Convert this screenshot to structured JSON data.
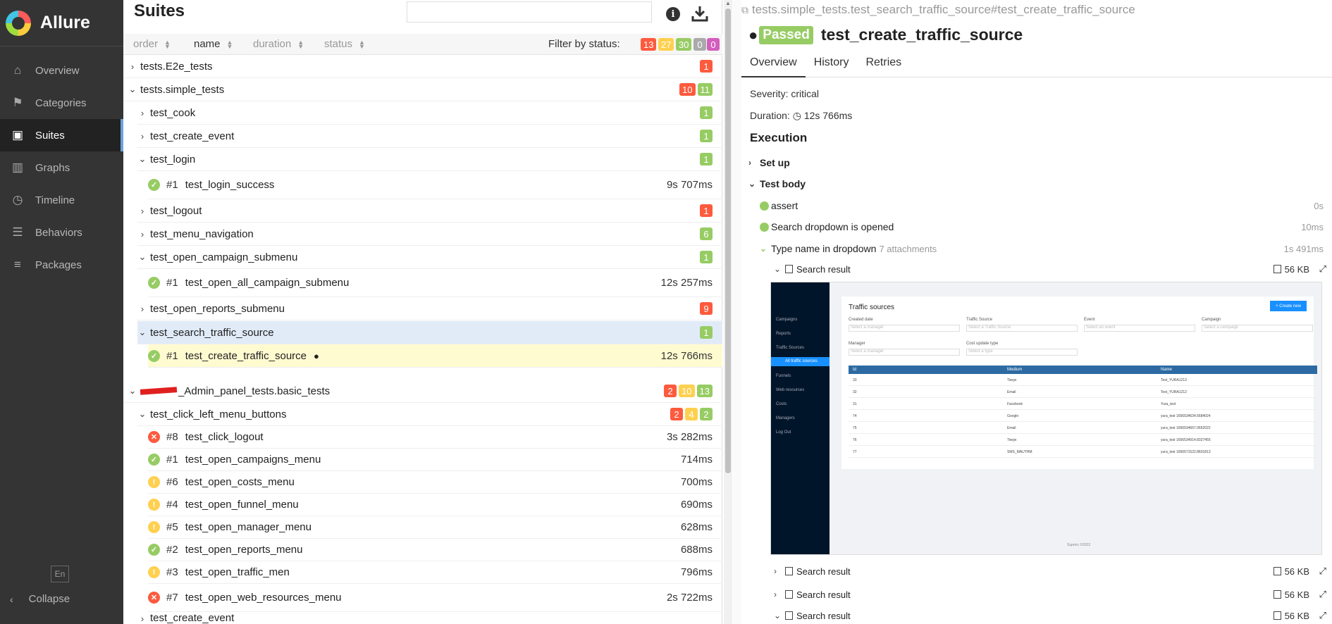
{
  "app": {
    "brand": "Allure",
    "language": "En",
    "collapse_label": "Collapse"
  },
  "nav": [
    {
      "label": "Overview",
      "icon": "home-icon"
    },
    {
      "label": "Categories",
      "icon": "flag-icon"
    },
    {
      "label": "Suites",
      "icon": "briefcase-icon",
      "active": true
    },
    {
      "label": "Graphs",
      "icon": "bar-chart-icon"
    },
    {
      "label": "Timeline",
      "icon": "clock-icon"
    },
    {
      "label": "Behaviors",
      "icon": "list-icon"
    },
    {
      "label": "Packages",
      "icon": "align-left-icon"
    }
  ],
  "suites": {
    "title": "Suites",
    "sort": {
      "order": "order",
      "name": "name",
      "duration": "duration",
      "status": "status"
    },
    "filter_label": "Filter by status:",
    "filter_counts": {
      "failed": "13",
      "broken": "27",
      "passed": "30",
      "skipped": "0",
      "unknown": "0"
    },
    "rows": [
      {
        "text": "tests.E2e_tests",
        "caret": "›",
        "badges": [
          "1"
        ]
      },
      {
        "text": "tests.simple_tests",
        "caret": "⌄",
        "badges": [
          "10",
          "11"
        ]
      },
      {
        "text": "test_cook",
        "badges": [
          "1"
        ]
      },
      {
        "text": "test_create_event",
        "badges": [
          "1"
        ]
      },
      {
        "text": "test_login",
        "badges": [
          "1"
        ]
      },
      {
        "num": "#1",
        "text": "test_login_success",
        "dur": "9s 707ms"
      },
      {
        "text": "test_logout",
        "badges": [
          "1"
        ]
      },
      {
        "text": "test_menu_navigation",
        "badges": [
          "6"
        ]
      },
      {
        "text": "test_open_campaign_submenu",
        "badges": [
          "1"
        ]
      },
      {
        "num": "#1",
        "text": "test_open_all_campaign_submenu",
        "dur": "12s 257ms"
      },
      {
        "text": "test_open_reports_submenu",
        "badges": [
          "9"
        ]
      },
      {
        "text": "test_search_traffic_source",
        "badges": [
          "1"
        ]
      },
      {
        "num": "#1",
        "text": "test_create_traffic_source",
        "dur": "12s 766ms"
      },
      {
        "text": "_Admin_panel_tests.basic_tests",
        "badges": [
          "2",
          "10",
          "13"
        ]
      },
      {
        "text": "test_click_left_menu_buttons",
        "badges": [
          "2",
          "4",
          "2"
        ]
      },
      {
        "num": "#8",
        "text": "test_click_logout",
        "dur": "3s 282ms"
      },
      {
        "num": "#1",
        "text": "test_open_campaigns_menu",
        "dur": "714ms"
      },
      {
        "num": "#6",
        "text": "test_open_costs_menu",
        "dur": "700ms"
      },
      {
        "num": "#4",
        "text": "test_open_funnel_menu",
        "dur": "690ms"
      },
      {
        "num": "#5",
        "text": "test_open_manager_menu",
        "dur": "628ms"
      },
      {
        "num": "#2",
        "text": "test_open_reports_menu",
        "dur": "688ms"
      },
      {
        "num": "#3",
        "text": "test_open_traffic_men",
        "dur": "796ms"
      },
      {
        "num": "#7",
        "text": "test_open_web_resources_menu",
        "dur": "2s 722ms"
      },
      {
        "text": "test_create_event"
      }
    ]
  },
  "detail": {
    "path": "tests.simple_tests.test_search_traffic_source#test_create_traffic_source",
    "status": "Passed",
    "name": "test_create_traffic_source",
    "tabs": [
      "Overview",
      "History",
      "Retries"
    ],
    "severity": "Severity: critical",
    "duration_label": "Duration:",
    "duration": "12s 766ms",
    "execution": "Execution",
    "set_up": "Set up",
    "test_body": "Test body",
    "steps": [
      {
        "label": "assert",
        "time": "0s"
      },
      {
        "label": "Search dropdown is opened",
        "time": "10ms"
      },
      {
        "label": "Type name in dropdown",
        "attachments": "7 attachments",
        "time": "1s 491ms"
      }
    ],
    "attachments": [
      {
        "label": "Search result",
        "size": "56 KB"
      },
      {
        "label": "Search result",
        "size": "56 KB"
      },
      {
        "label": "Search result",
        "size": "56 KB"
      },
      {
        "label": "Search result",
        "size": "56 KB"
      }
    ]
  },
  "preview": {
    "menu": [
      "Campaigns",
      "Reports",
      "Traffic Sources",
      "All traffic sources",
      "Funnels",
      "Web resources",
      "Costs",
      "Managers",
      "Log Out"
    ],
    "title": "Traffic sources",
    "create_btn": "+ Create new",
    "labels": [
      "Created date",
      "Traffic Source",
      "Event",
      "Campaign",
      "Manager",
      "Cost update type"
    ],
    "placeholders": [
      "Select a manager",
      "Select a Traffic Source",
      "Select an event",
      "Select a campaign",
      "Select a manager",
      "Select a type"
    ],
    "columns": [
      "Id",
      "Medium",
      "Name"
    ],
    "rows": [
      [
        "33",
        "Тіккук",
        "Test_YURA1213"
      ],
      [
        "32",
        "Email",
        "Test_YURA1212"
      ],
      [
        "31",
        "Facebook",
        "Yura_test"
      ],
      [
        "74",
        "Google",
        "yura_test 1656534634.5684024"
      ],
      [
        "75",
        "Email",
        "yura_test 1656534667.0662022"
      ],
      [
        "76",
        "Тіккук",
        "yura_test 1656534914.8327455"
      ],
      [
        "77",
        "SMS_MAUTHM",
        "yura_test 1656571522.8601813"
      ]
    ],
    "footer": "Suprnic ©2022"
  }
}
